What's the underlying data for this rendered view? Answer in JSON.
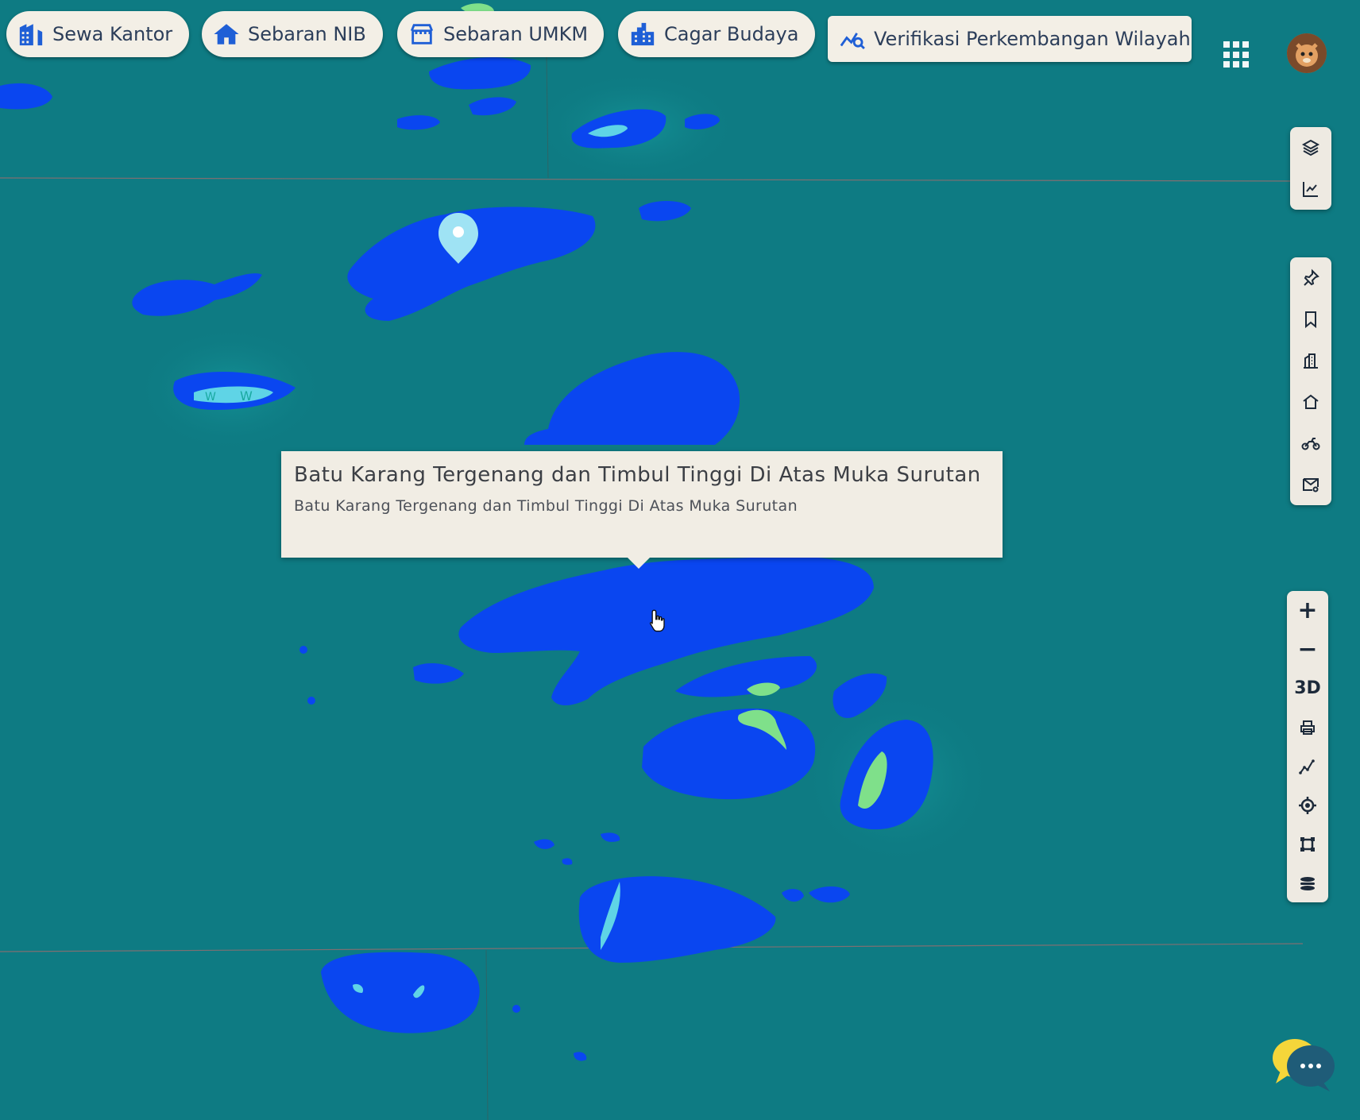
{
  "colors": {
    "sea": "#0e7b83",
    "reef": "#0a46f0",
    "land": "#7fe08a",
    "chip_bg": "#f3efe6",
    "chip_icon": "#1f5fd6",
    "popup_bg": "#f1ede4",
    "marker": "#9fe3f4"
  },
  "topbar": {
    "chips": [
      {
        "label": "Sewa Kantor",
        "icon": "office-building-icon"
      },
      {
        "label": "Sebaran NIB",
        "icon": "home-icon"
      },
      {
        "label": "Sebaran UMKM",
        "icon": "store-icon"
      },
      {
        "label": "Cagar Budaya",
        "icon": "city-buildings-icon"
      },
      {
        "label": "Verifikasi Perkembangan Wilayah",
        "icon": "chart-search-icon"
      }
    ],
    "apps_icon": "grid-apps-icon",
    "avatar_icon": "user-avatar-icon"
  },
  "toolbar_top": [
    {
      "icon": "layers-icon"
    },
    {
      "icon": "line-chart-icon"
    }
  ],
  "toolbar_middle": [
    {
      "icon": "pin-icon"
    },
    {
      "icon": "bookmark-icon"
    },
    {
      "icon": "building-icon"
    },
    {
      "icon": "home-outline-icon"
    },
    {
      "icon": "motorcycle-icon"
    },
    {
      "icon": "mail-icon"
    }
  ],
  "toolbar_bottom": {
    "zoom_in": "+",
    "zoom_out": "−",
    "view_3d": "3D",
    "icons": [
      "print-icon",
      "measure-icon",
      "locate-icon",
      "crop-icon",
      "stack-icon"
    ]
  },
  "popup": {
    "title": "Batu Karang Tergenang dan Timbul Tinggi Di Atas Muka Surutan",
    "subtitle": "Batu Karang Tergenang dan Timbul Tinggi Di Atas Muka Surutan"
  },
  "chat": {
    "icon": "chat-bubble-icon"
  }
}
